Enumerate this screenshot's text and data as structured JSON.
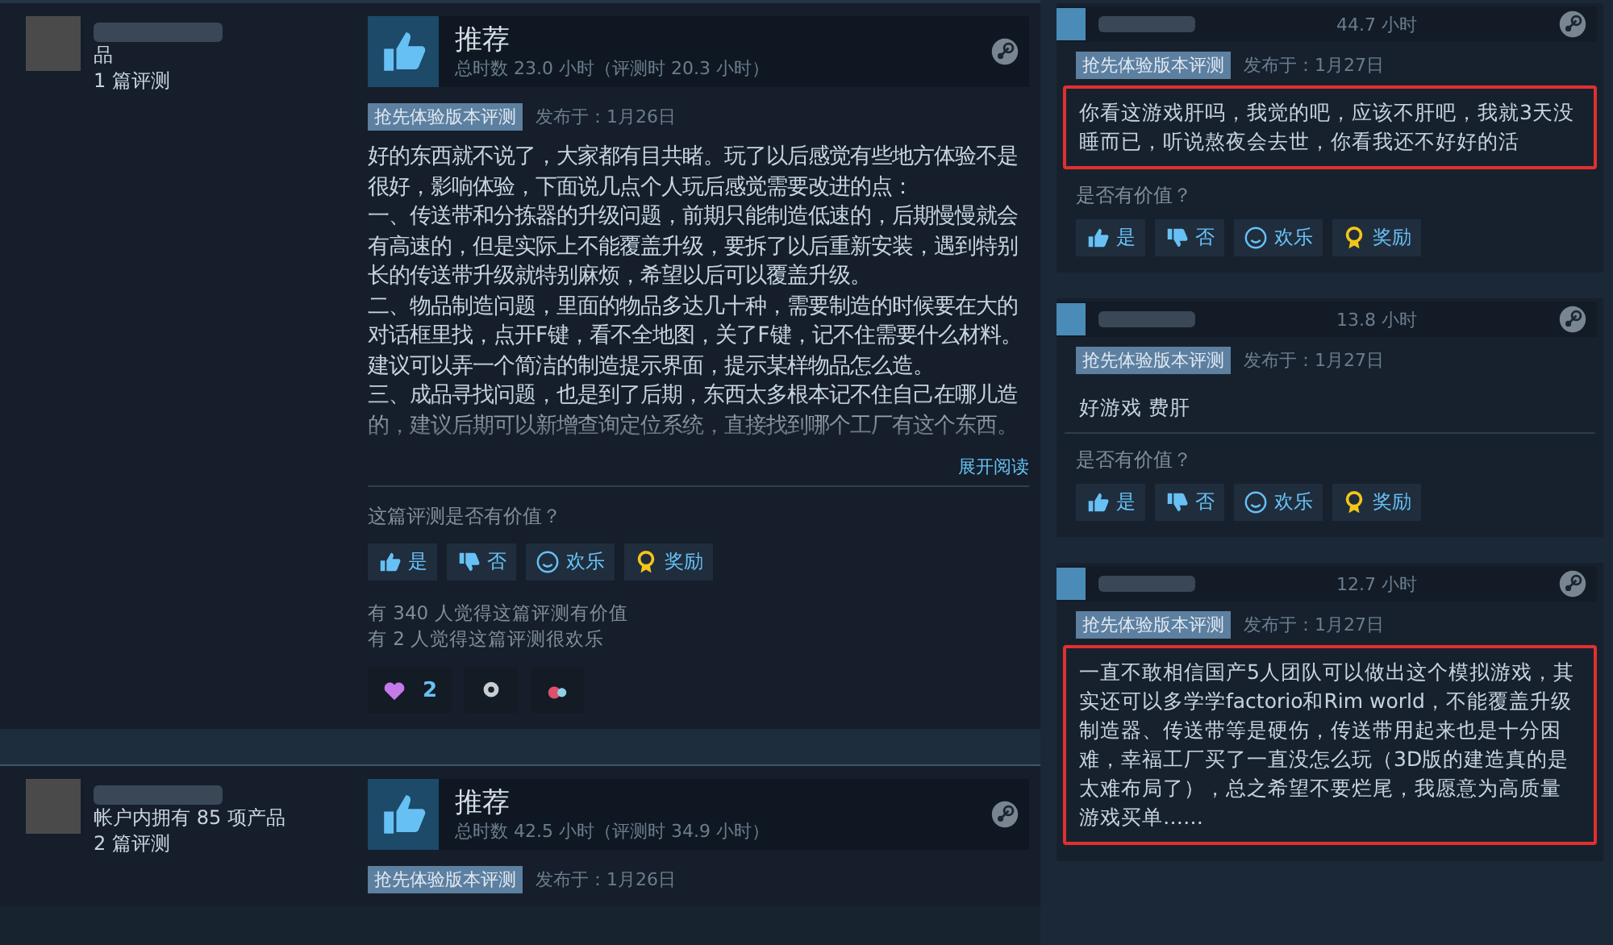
{
  "reviews": [
    {
      "profile": {
        "products": "品",
        "reviews": "1 篇评测"
      },
      "verdict": "推荐",
      "hours": "总时数 23.0 小时（评测时 20.3 小时）",
      "tag": "抢先体验版本评测",
      "date": "发布于：1月26日",
      "paragraphs": [
        "好的东西就不说了，大家都有目共睹。玩了以后感觉有些地方体验不是很好，影响体验，下面说几点个人玩后感觉需要改进的点：",
        "一、传送带和分拣器的升级问题，前期只能制造低速的，后期慢慢就会有高速的，但是实际上不能覆盖升级，要拆了以后重新安装，遇到特别长的传送带升级就特别麻烦，希望以后可以覆盖升级。",
        "二、物品制造问题，里面的物品多达几十种，需要制造的时候要在大的对话框里找，点开F键，看不全地图，关了F键，记不住需要什么材料。建议可以弄一个简洁的制造提示界面，提示某样物品怎么造。",
        "三、成品寻找问题，也是到了后期，东西太多根本记不住自己在哪儿造的，建议后期可以新增查询定位系统，直接找到哪个工厂有这个东西。"
      ],
      "expand": "展开阅读",
      "helpful_prompt": "这篇评测是否有价值？",
      "vote_buttons": [
        {
          "kind": "yes",
          "label": "是"
        },
        {
          "kind": "no",
          "label": "否"
        },
        {
          "kind": "funny",
          "label": "欢乐"
        },
        {
          "kind": "award",
          "label": "奖励"
        }
      ],
      "counts": [
        "有 340 人觉得这篇评测有价值",
        "有 2 人觉得这篇评测很欢乐"
      ],
      "awards": [
        {
          "kind": "heart",
          "count": "2"
        },
        {
          "kind": "eye"
        },
        {
          "kind": "berry"
        }
      ]
    },
    {
      "profile": {
        "products": "帐户内拥有 85 项产品",
        "reviews": "2 篇评测"
      },
      "verdict": "推荐",
      "hours": "总时数 42.5 小时（评测时 34.9 小时）",
      "tag": "抢先体验版本评测",
      "date": "发布于：1月26日"
    }
  ],
  "side_reviews": [
    {
      "hours": "44.7 小时",
      "tag": "抢先体验版本评测",
      "date": "发布于：1月27日",
      "body": "你看这游戏肝吗，我觉的吧，应该不肝吧，我就3天没睡而已，听说熬夜会去世，你看我还不好好的活",
      "highlighted": true,
      "helpful_prompt": "是否有价值？",
      "vote_buttons": [
        {
          "kind": "yes",
          "label": "是"
        },
        {
          "kind": "no",
          "label": "否"
        },
        {
          "kind": "funny",
          "label": "欢乐"
        },
        {
          "kind": "award",
          "label": "奖励"
        }
      ]
    },
    {
      "hours": "13.8 小时",
      "tag": "抢先体验版本评测",
      "date": "发布于：1月27日",
      "body": "好游戏 费肝",
      "highlighted": false,
      "helpful_prompt": "是否有价值？",
      "vote_buttons": [
        {
          "kind": "yes",
          "label": "是"
        },
        {
          "kind": "no",
          "label": "否"
        },
        {
          "kind": "funny",
          "label": "欢乐"
        },
        {
          "kind": "award",
          "label": "奖励"
        }
      ]
    },
    {
      "hours": "12.7 小时",
      "tag": "抢先体验版本评测",
      "date": "发布于：1月27日",
      "body": "一直不敢相信国产5人团队可以做出这个模拟游戏，其实还可以多学学factorio和Rim world，不能覆盖升级制造器、传送带等是硬伤，传送带用起来也是十分困难，幸福工厂买了一直没怎么玩（3D版的建造真的是太难布局了），总之希望不要烂尾，我愿意为高质量游戏买单……",
      "highlighted": true
    }
  ]
}
